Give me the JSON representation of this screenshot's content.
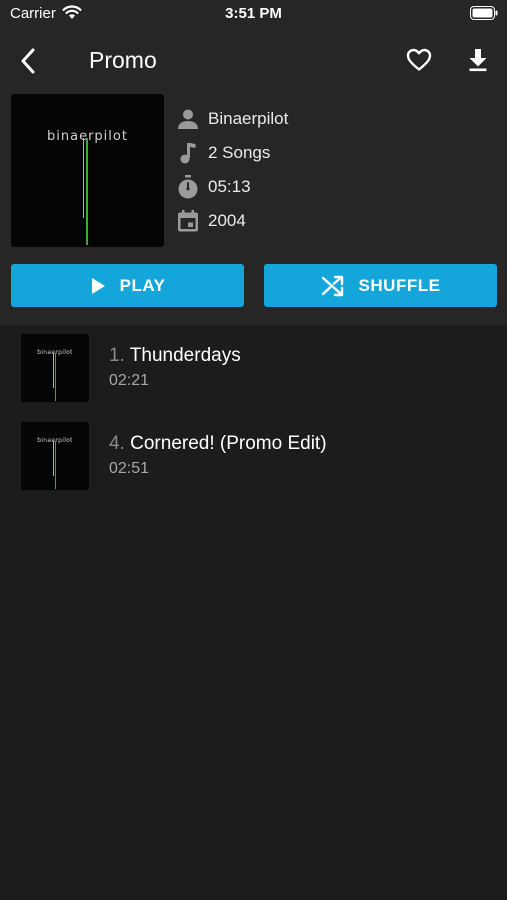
{
  "status_bar": {
    "carrier": "Carrier",
    "time": "3:51 PM"
  },
  "header": {
    "title": "Promo"
  },
  "album": {
    "cover_text": "binaerpilot",
    "artist": "Binaerpilot",
    "songs": "2 Songs",
    "duration": "05:13",
    "year": "2004"
  },
  "actions": {
    "play_label": "PLAY",
    "shuffle_label": "SHUFFLE"
  },
  "tracks": [
    {
      "number": "1.",
      "title": "Thunderdays",
      "duration": "02:21"
    },
    {
      "number": "4.",
      "title": "Cornered! (Promo Edit)",
      "duration": "02:51"
    }
  ],
  "colors": {
    "accent": "#14a6db",
    "header_bg": "#262626",
    "list_bg": "#1c1c1c",
    "cover_line": "#3ea83a"
  },
  "icons": [
    "wifi-icon",
    "battery-icon",
    "back-icon",
    "heart-icon",
    "download-icon",
    "person-icon",
    "music-note-icon",
    "timer-icon",
    "calendar-icon",
    "play-icon",
    "shuffle-icon"
  ]
}
